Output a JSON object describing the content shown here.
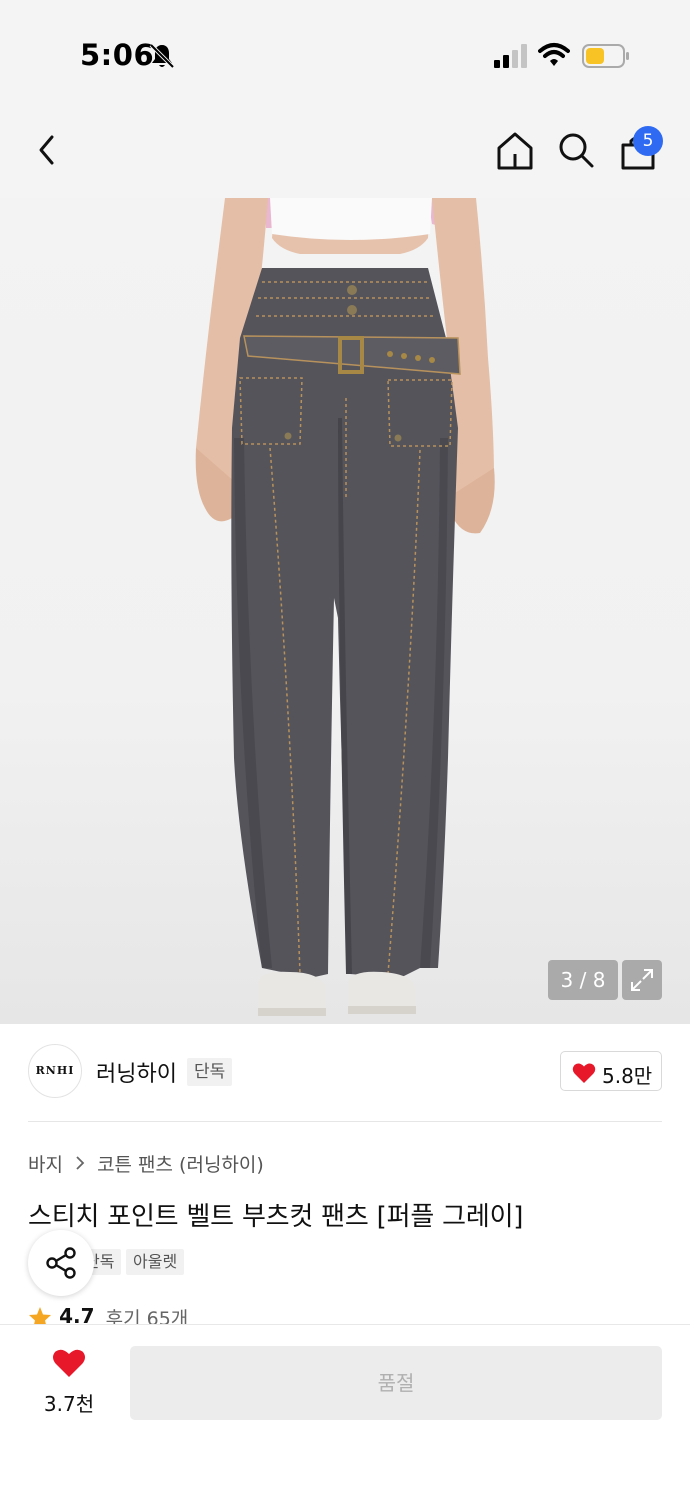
{
  "status_bar": {
    "time": "5:06",
    "battery_color": "#f7c325"
  },
  "nav": {
    "cart_count": "5"
  },
  "gallery": {
    "counter": "3 / 8"
  },
  "brand": {
    "logo_text": "RNHI",
    "name": "러닝하이",
    "tag": "단독"
  },
  "likes": {
    "count": "5.8만"
  },
  "breadcrumb": {
    "category": "바지",
    "subcategory": "코튼 팬츠 (러닝하이)"
  },
  "product": {
    "title": "스티치 포인트 벨트 부츠컷 팬츠 [퍼플 그레이]",
    "tags": [
      "단독",
      "아울렛"
    ],
    "rating": "4.7",
    "reviews": "후기 65개"
  },
  "bottom": {
    "wish_count": "3.7천",
    "cta_label": "품절"
  },
  "colors": {
    "accent_blue": "#2f6bf2",
    "heart_red": "#e8182b",
    "star": "#f5a623",
    "denim": "#55545b"
  }
}
